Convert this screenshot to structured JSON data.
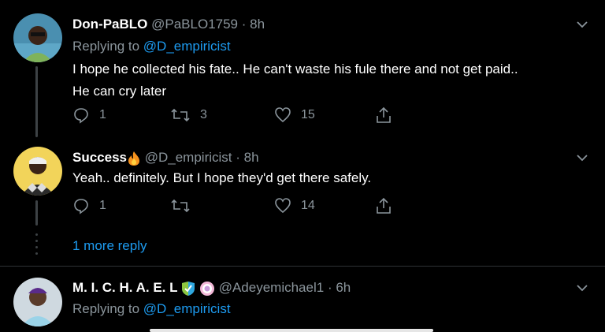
{
  "tweets": [
    {
      "name": "Don-PaBLO",
      "handle": "@PaBLO1759",
      "time": "· 8h",
      "replying_prefix": "Replying to ",
      "replying_to": "@D_empiricist",
      "text_line1": "I hope he collected his fate.. He can't waste his fule there and not get paid..",
      "text_line2": "He can cry later",
      "replies": "1",
      "retweets": "3",
      "likes": "15"
    },
    {
      "name": "Success",
      "name_emoji": "fire-icon",
      "handle": "@D_empiricist",
      "time": "· 8h",
      "text_line1": "Yeah.. definitely. But I hope they'd get there safely.",
      "replies": "1",
      "retweets": "",
      "likes": "14"
    },
    {
      "name": "M. I. C. H. A. E. L",
      "name_emoji": "check-badge-icon",
      "handle": "@Adeyemichael1",
      "time": "· 6h",
      "replying_prefix": "Replying to ",
      "replying_to": "@D_empiricist"
    }
  ],
  "more_replies": "1 more reply",
  "colors": {
    "accent": "#1d9bf0",
    "muted": "#8b959c",
    "background": "#000000"
  }
}
